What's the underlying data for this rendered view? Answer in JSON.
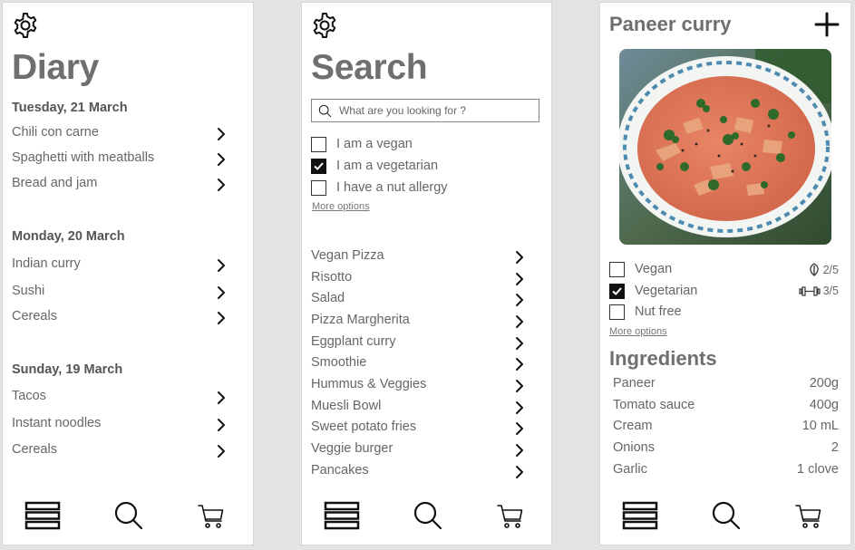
{
  "diary": {
    "title": "Diary",
    "days": [
      {
        "date": "Tuesday, 21 March",
        "meals": [
          "Chili con carne",
          "Spaghetti with meatballs",
          "Bread and jam"
        ]
      },
      {
        "date": "Monday, 20 March",
        "meals": [
          "Indian curry",
          "Sushi",
          "Cereals"
        ]
      },
      {
        "date": "Sunday, 19 March",
        "meals": [
          "Tacos",
          "Instant noodles",
          "Cereals"
        ]
      }
    ]
  },
  "search": {
    "title": "Search",
    "placeholder": "What are you looking for ?",
    "filters": [
      {
        "label": "I am a vegan",
        "checked": false
      },
      {
        "label": "I am a vegetarian",
        "checked": true
      },
      {
        "label": "I have a nut allergy",
        "checked": false
      }
    ],
    "more_options": "More options",
    "results": [
      "Vegan Pizza",
      "Risotto",
      "Salad",
      "Pizza Margherita",
      "Eggplant curry",
      "Smoothie",
      "Hummus & Veggies",
      "Muesli Bowl",
      "Sweet potato fries",
      "Veggie burger",
      "Pancakes"
    ]
  },
  "recipe": {
    "title": "Paneer curry",
    "tags": [
      {
        "label": "Vegan",
        "checked": false,
        "rating": "2/5",
        "icon": "leaf-icon"
      },
      {
        "label": "Vegetarian",
        "checked": true,
        "rating": "3/5",
        "icon": "dumbbell-icon"
      },
      {
        "label": "Nut free",
        "checked": false
      }
    ],
    "more_options": "More options",
    "ingredients_title": "Ingredients",
    "ingredients": [
      {
        "name": "Paneer",
        "amount": "200g"
      },
      {
        "name": "Tomato sauce",
        "amount": "400g"
      },
      {
        "name": "Cream",
        "amount": "10 mL"
      },
      {
        "name": "Onions",
        "amount": "2"
      },
      {
        "name": "Garlic",
        "amount": "1 clove"
      }
    ]
  },
  "colors": {
    "title": "#6f6f6f",
    "text": "#666666",
    "checkbox_checked": "#111111",
    "curry": "#e07a5a",
    "bowl": "#f3f5f2"
  }
}
